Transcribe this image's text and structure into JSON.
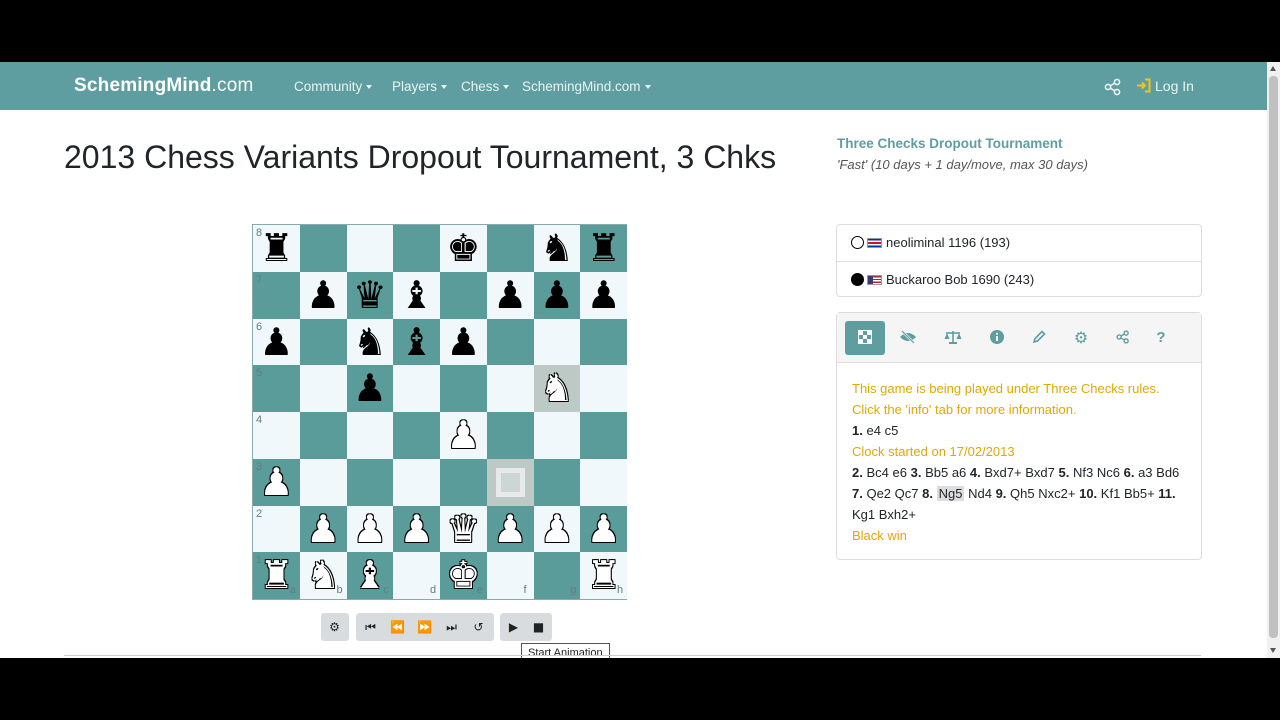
{
  "navbar": {
    "brand": "SchemingMind",
    "brand_domain": ".com",
    "items": [
      "Community",
      "Players",
      "Chess",
      "SchemingMind.com"
    ],
    "login_label": "Log In",
    "color": "#5f9ea0"
  },
  "page": {
    "title": "2013 Chess Variants Dropout Tournament, 3 Chks"
  },
  "tournament": {
    "name": "Three Checks Dropout Tournament",
    "time_control": "'Fast' (10 days + 1 day/move, max 30 days)"
  },
  "players": [
    {
      "color": "white",
      "name": "neoliminal",
      "rating": "1196 (193)",
      "flag": "costa-rica-flag"
    },
    {
      "color": "black",
      "name": "Buckaroo Bob",
      "rating": "1690 (243)",
      "flag": "us-flag"
    }
  ],
  "board": {
    "files": [
      "a",
      "b",
      "c",
      "d",
      "e",
      "f",
      "g",
      "h"
    ],
    "ranks": [
      "8",
      "7",
      "6",
      "5",
      "4",
      "3",
      "2",
      "1"
    ],
    "position": [
      [
        "r",
        "",
        "",
        "",
        "k",
        "",
        "n",
        "r"
      ],
      [
        "",
        "p",
        "q",
        "b",
        "",
        "p",
        "p",
        "p"
      ],
      [
        "p",
        "",
        "n",
        "b",
        "p",
        "",
        "",
        ""
      ],
      [
        "",
        "",
        "p",
        "",
        "",
        "",
        "N",
        ""
      ],
      [
        "",
        "",
        "",
        "",
        "P",
        "",
        "",
        ""
      ],
      [
        "P",
        "",
        "",
        "",
        "",
        "",
        "",
        ""
      ],
      [
        "",
        "P",
        "P",
        "P",
        "Q",
        "P",
        "P",
        "P"
      ],
      [
        "R",
        "N",
        "B",
        "",
        "K",
        "",
        "",
        "R"
      ]
    ],
    "highlight": [
      "g5",
      "f3"
    ]
  },
  "controls": {
    "buttons": [
      "settings",
      "first",
      "prev",
      "next",
      "last",
      "flip",
      "play",
      "stop"
    ],
    "tooltip": "Start Animation"
  },
  "panel": {
    "tabs": [
      "board-tab",
      "hide-tab",
      "balance-tab",
      "info-tab",
      "pen-tab",
      "settings-tab",
      "share-tab",
      "help-tab"
    ],
    "note1": "This game is being played under Three Checks rules.",
    "note2": "Click the 'info' tab for more information.",
    "moves_a": "1. e4 c5",
    "clock_note": "Clock started on 17/02/2013",
    "moves_b": "2. Bc4 e6 3. Bb5 a6 4. Bxd7+ Bxd7 5. Nf3 Nc6 6. a3 Bd6 7. Qe2 Qc7 8. Ng5 Nd4 9. Qh5 Nxc2+ 10. Kf1 Bb5+ 11. Kg1 Bxh2+",
    "result": "Black win"
  }
}
